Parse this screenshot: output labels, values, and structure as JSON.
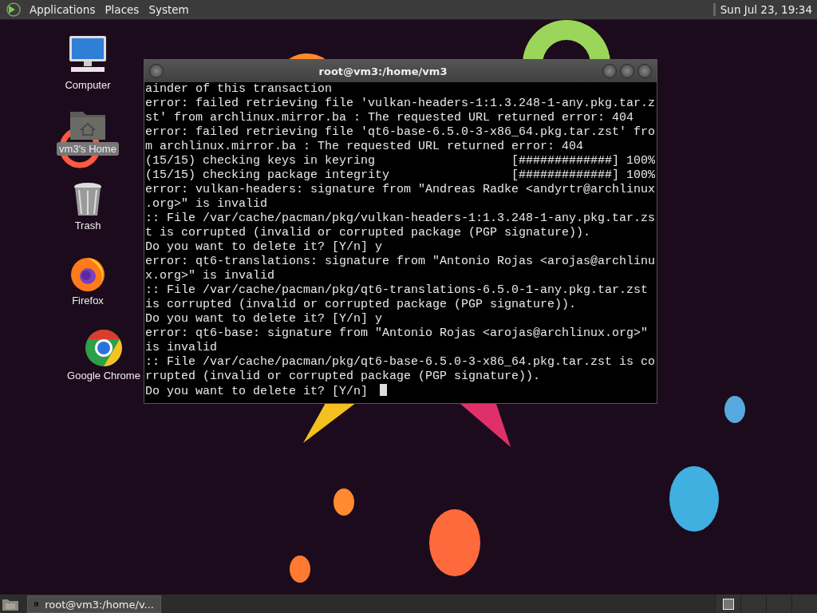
{
  "top_panel": {
    "menus": [
      "Applications",
      "Places",
      "System"
    ],
    "clock": "Sun Jul 23, 19:34"
  },
  "desktop_icons": [
    {
      "kind": "computer",
      "label": "Computer",
      "selected": false
    },
    {
      "kind": "home",
      "label": "vm3's Home",
      "selected": true
    },
    {
      "kind": "trash",
      "label": "Trash",
      "selected": false
    },
    {
      "kind": "firefox",
      "label": "Firefox",
      "selected": false
    },
    {
      "kind": "chrome",
      "label": "Google Chrome",
      "selected": false
    }
  ],
  "terminal": {
    "title": "root@vm3:/home/vm3",
    "cursor": true,
    "lines": [
      "ainder of this transaction",
      "error: failed retrieving file 'vulkan-headers-1:1.3.248-1-any.pkg.tar.z",
      "st' from archlinux.mirror.ba : The requested URL returned error: 404",
      "error: failed retrieving file 'qt6-base-6.5.0-3-x86_64.pkg.tar.zst' fro",
      "m archlinux.mirror.ba : The requested URL returned error: 404",
      "(15/15) checking keys in keyring                   [#############] 100%",
      "(15/15) checking package integrity                 [#############] 100%",
      "error: vulkan-headers: signature from \"Andreas Radke <andyrtr@archlinux",
      ".org>\" is invalid",
      ":: File /var/cache/pacman/pkg/vulkan-headers-1:1.3.248-1-any.pkg.tar.zs",
      "t is corrupted (invalid or corrupted package (PGP signature)).",
      "Do you want to delete it? [Y/n] y",
      "error: qt6-translations: signature from \"Antonio Rojas <arojas@archlinu",
      "x.org>\" is invalid",
      ":: File /var/cache/pacman/pkg/qt6-translations-6.5.0-1-any.pkg.tar.zst",
      "is corrupted (invalid or corrupted package (PGP signature)).",
      "Do you want to delete it? [Y/n] y",
      "error: qt6-base: signature from \"Antonio Rojas <arojas@archlinux.org>\"",
      "is invalid",
      ":: File /var/cache/pacman/pkg/qt6-base-6.5.0-3-x86_64.pkg.tar.zst is co",
      "rrupted (invalid or corrupted package (PGP signature)).",
      "Do you want to delete it? [Y/n] "
    ]
  },
  "bottom_panel": {
    "tasks": [
      {
        "label": "root@vm3:/home/v...",
        "selected": false
      }
    ],
    "workspaces": [
      {
        "selected": true
      },
      {
        "selected": false
      },
      {
        "selected": false
      },
      {
        "selected": false
      }
    ]
  }
}
